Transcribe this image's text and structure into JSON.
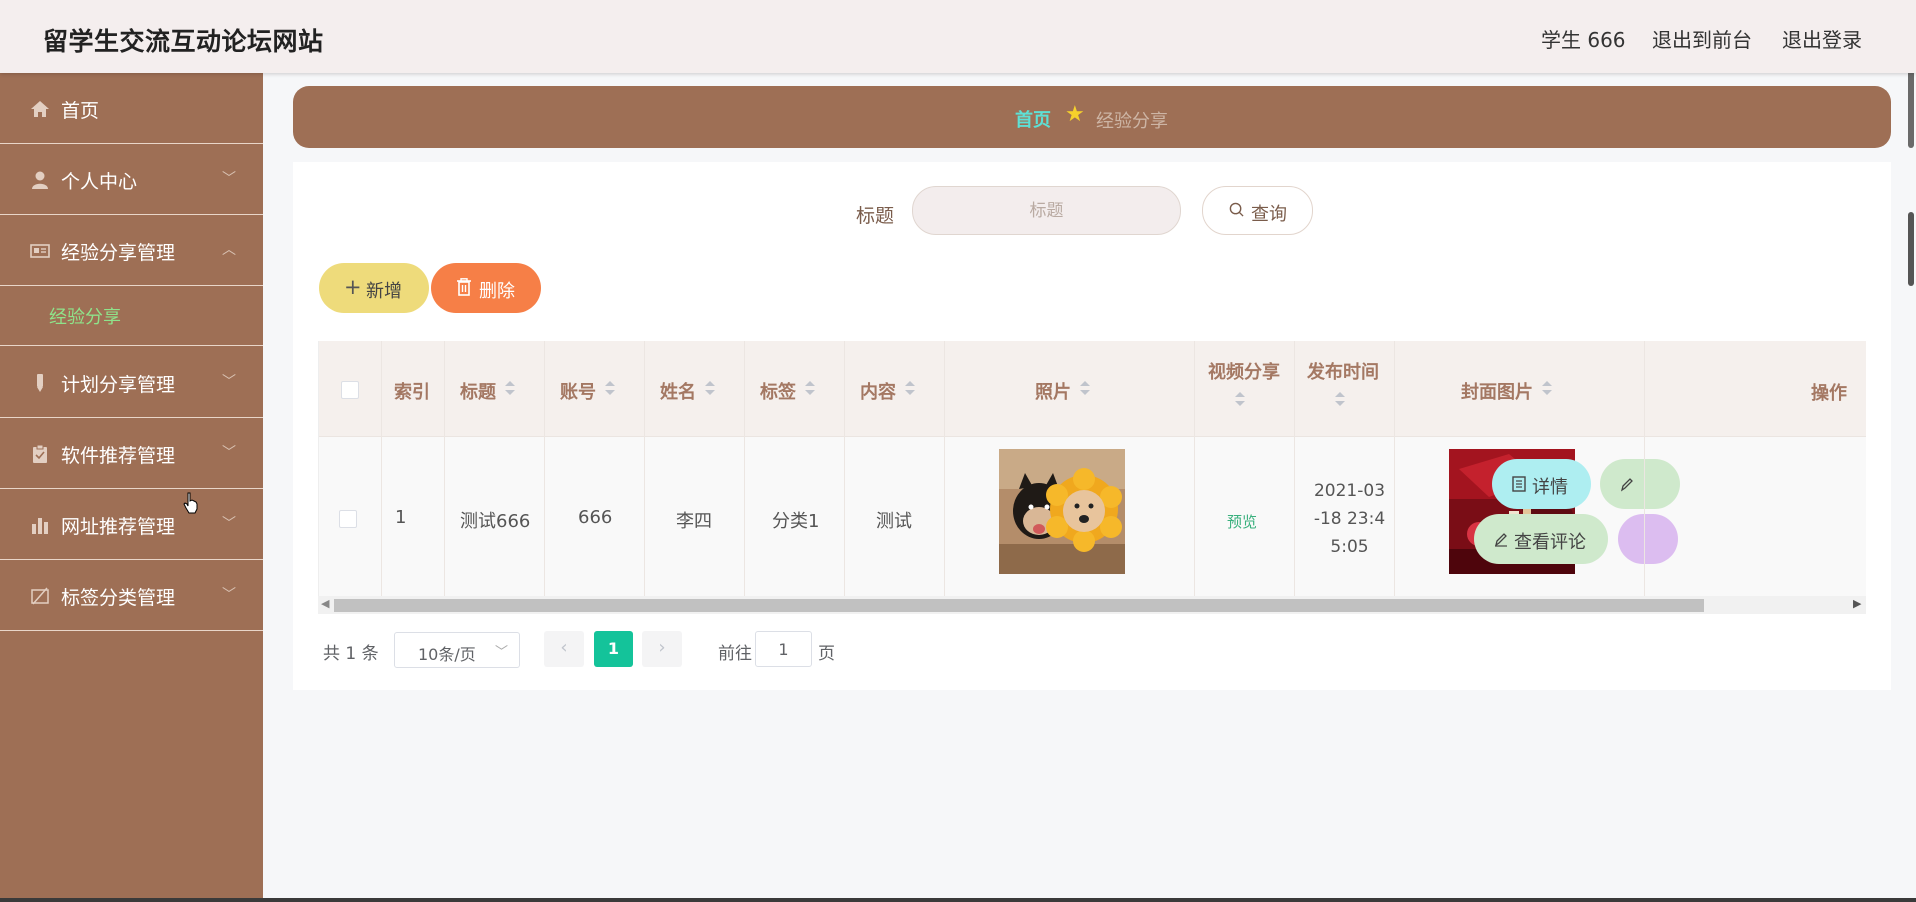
{
  "header": {
    "brand": "留学生交流互动论坛网站",
    "user": "学生 666",
    "front_link": "退出到前台",
    "logout_link": "退出登录"
  },
  "sidebar": {
    "items": [
      {
        "label": "首页",
        "icon": "home-icon"
      },
      {
        "label": "个人中心",
        "icon": "user-icon",
        "chevron": "﹀"
      },
      {
        "label": "经验分享管理",
        "icon": "card-icon",
        "chevron": "︿"
      },
      {
        "label": "计划分享管理",
        "icon": "pen-icon",
        "chevron": "﹀"
      },
      {
        "label": "软件推荐管理",
        "icon": "clipboard-icon",
        "chevron": "﹀"
      },
      {
        "label": "网址推荐管理",
        "icon": "bar-chart-icon",
        "chevron": "﹀"
      },
      {
        "label": "标签分类管理",
        "icon": "tag-icon",
        "chevron": "﹀"
      }
    ],
    "sub_item": "经验分享"
  },
  "breadcrumb": {
    "home": "首页",
    "current": "经验分享"
  },
  "search": {
    "label": "标题",
    "placeholder": "标题",
    "button": "查询"
  },
  "actions": {
    "add": "新增",
    "delete": "删除"
  },
  "table": {
    "headers": [
      "索引",
      "标题",
      "账号",
      "姓名",
      "标签",
      "内容",
      "照片",
      "视频分享",
      "发布时间",
      "封面图片",
      "操作"
    ],
    "rows": [
      {
        "index": "1",
        "title": "测试666",
        "account": "666",
        "name": "李四",
        "tag": "分类1",
        "content": "测试",
        "video": "预览",
        "time": "2021-03-18 23:45:05",
        "time_lines": [
          "2021-03",
          "-18 23:4",
          "5:05"
        ]
      }
    ],
    "row_actions": {
      "detail": "详情",
      "comments": "查看评论"
    }
  },
  "pagination": {
    "total": "共 1 条",
    "page_size": "10条/页",
    "current": "1",
    "goto_prefix": "前往",
    "goto_value": "1",
    "goto_suffix": "页"
  },
  "colors": {
    "sidebar_bg": "#9e6f55",
    "accent_green": "#14c39a",
    "add_button": "#eedb7b",
    "delete_button": "#f67f47"
  }
}
